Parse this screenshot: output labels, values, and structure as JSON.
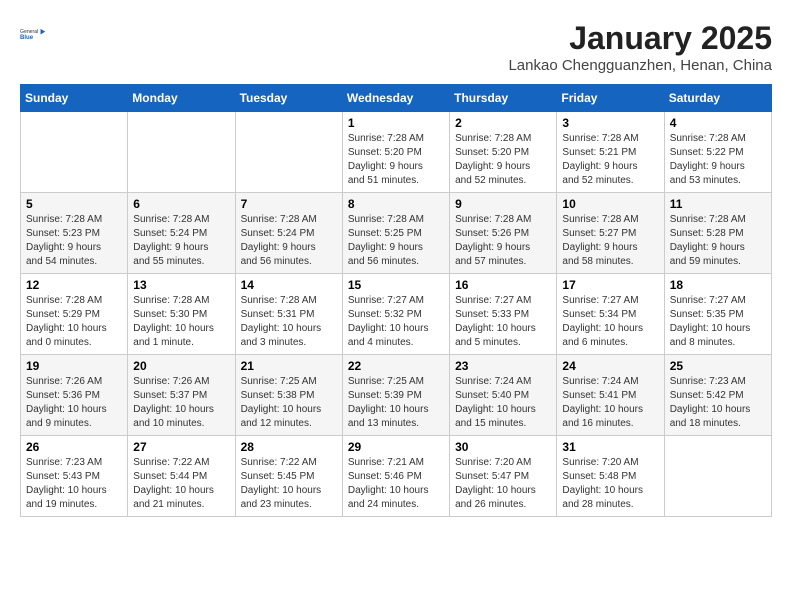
{
  "header": {
    "logo_line1": "General",
    "logo_line2": "Blue",
    "title": "January 2025",
    "subtitle": "Lankao Chengguanzhen, Henan, China"
  },
  "weekdays": [
    "Sunday",
    "Monday",
    "Tuesday",
    "Wednesday",
    "Thursday",
    "Friday",
    "Saturday"
  ],
  "weeks": [
    [
      {
        "day": "",
        "info": ""
      },
      {
        "day": "",
        "info": ""
      },
      {
        "day": "",
        "info": ""
      },
      {
        "day": "1",
        "info": "Sunrise: 7:28 AM\nSunset: 5:20 PM\nDaylight: 9 hours\nand 51 minutes."
      },
      {
        "day": "2",
        "info": "Sunrise: 7:28 AM\nSunset: 5:20 PM\nDaylight: 9 hours\nand 52 minutes."
      },
      {
        "day": "3",
        "info": "Sunrise: 7:28 AM\nSunset: 5:21 PM\nDaylight: 9 hours\nand 52 minutes."
      },
      {
        "day": "4",
        "info": "Sunrise: 7:28 AM\nSunset: 5:22 PM\nDaylight: 9 hours\nand 53 minutes."
      }
    ],
    [
      {
        "day": "5",
        "info": "Sunrise: 7:28 AM\nSunset: 5:23 PM\nDaylight: 9 hours\nand 54 minutes."
      },
      {
        "day": "6",
        "info": "Sunrise: 7:28 AM\nSunset: 5:24 PM\nDaylight: 9 hours\nand 55 minutes."
      },
      {
        "day": "7",
        "info": "Sunrise: 7:28 AM\nSunset: 5:24 PM\nDaylight: 9 hours\nand 56 minutes."
      },
      {
        "day": "8",
        "info": "Sunrise: 7:28 AM\nSunset: 5:25 PM\nDaylight: 9 hours\nand 56 minutes."
      },
      {
        "day": "9",
        "info": "Sunrise: 7:28 AM\nSunset: 5:26 PM\nDaylight: 9 hours\nand 57 minutes."
      },
      {
        "day": "10",
        "info": "Sunrise: 7:28 AM\nSunset: 5:27 PM\nDaylight: 9 hours\nand 58 minutes."
      },
      {
        "day": "11",
        "info": "Sunrise: 7:28 AM\nSunset: 5:28 PM\nDaylight: 9 hours\nand 59 minutes."
      }
    ],
    [
      {
        "day": "12",
        "info": "Sunrise: 7:28 AM\nSunset: 5:29 PM\nDaylight: 10 hours\nand 0 minutes."
      },
      {
        "day": "13",
        "info": "Sunrise: 7:28 AM\nSunset: 5:30 PM\nDaylight: 10 hours\nand 1 minute."
      },
      {
        "day": "14",
        "info": "Sunrise: 7:28 AM\nSunset: 5:31 PM\nDaylight: 10 hours\nand 3 minutes."
      },
      {
        "day": "15",
        "info": "Sunrise: 7:27 AM\nSunset: 5:32 PM\nDaylight: 10 hours\nand 4 minutes."
      },
      {
        "day": "16",
        "info": "Sunrise: 7:27 AM\nSunset: 5:33 PM\nDaylight: 10 hours\nand 5 minutes."
      },
      {
        "day": "17",
        "info": "Sunrise: 7:27 AM\nSunset: 5:34 PM\nDaylight: 10 hours\nand 6 minutes."
      },
      {
        "day": "18",
        "info": "Sunrise: 7:27 AM\nSunset: 5:35 PM\nDaylight: 10 hours\nand 8 minutes."
      }
    ],
    [
      {
        "day": "19",
        "info": "Sunrise: 7:26 AM\nSunset: 5:36 PM\nDaylight: 10 hours\nand 9 minutes."
      },
      {
        "day": "20",
        "info": "Sunrise: 7:26 AM\nSunset: 5:37 PM\nDaylight: 10 hours\nand 10 minutes."
      },
      {
        "day": "21",
        "info": "Sunrise: 7:25 AM\nSunset: 5:38 PM\nDaylight: 10 hours\nand 12 minutes."
      },
      {
        "day": "22",
        "info": "Sunrise: 7:25 AM\nSunset: 5:39 PM\nDaylight: 10 hours\nand 13 minutes."
      },
      {
        "day": "23",
        "info": "Sunrise: 7:24 AM\nSunset: 5:40 PM\nDaylight: 10 hours\nand 15 minutes."
      },
      {
        "day": "24",
        "info": "Sunrise: 7:24 AM\nSunset: 5:41 PM\nDaylight: 10 hours\nand 16 minutes."
      },
      {
        "day": "25",
        "info": "Sunrise: 7:23 AM\nSunset: 5:42 PM\nDaylight: 10 hours\nand 18 minutes."
      }
    ],
    [
      {
        "day": "26",
        "info": "Sunrise: 7:23 AM\nSunset: 5:43 PM\nDaylight: 10 hours\nand 19 minutes."
      },
      {
        "day": "27",
        "info": "Sunrise: 7:22 AM\nSunset: 5:44 PM\nDaylight: 10 hours\nand 21 minutes."
      },
      {
        "day": "28",
        "info": "Sunrise: 7:22 AM\nSunset: 5:45 PM\nDaylight: 10 hours\nand 23 minutes."
      },
      {
        "day": "29",
        "info": "Sunrise: 7:21 AM\nSunset: 5:46 PM\nDaylight: 10 hours\nand 24 minutes."
      },
      {
        "day": "30",
        "info": "Sunrise: 7:20 AM\nSunset: 5:47 PM\nDaylight: 10 hours\nand 26 minutes."
      },
      {
        "day": "31",
        "info": "Sunrise: 7:20 AM\nSunset: 5:48 PM\nDaylight: 10 hours\nand 28 minutes."
      },
      {
        "day": "",
        "info": ""
      }
    ]
  ]
}
